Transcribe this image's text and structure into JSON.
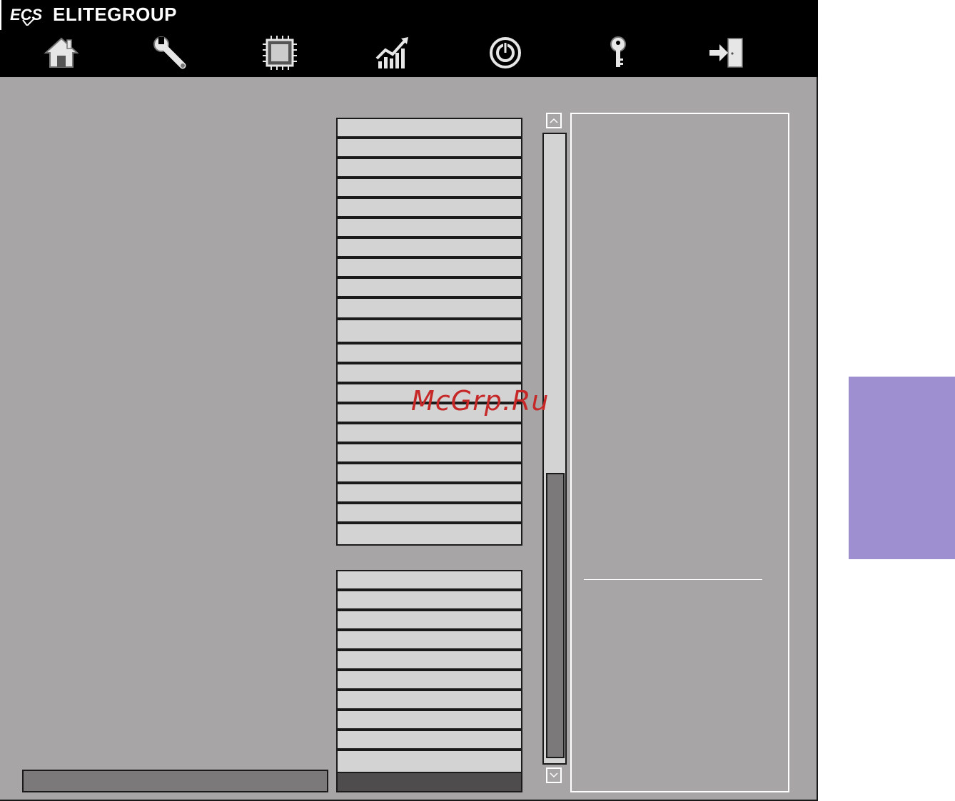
{
  "header": {
    "brand_logo": "ECS",
    "brand_name": "ELITEGROUP",
    "nav_items": [
      {
        "icon": "home-icon"
      },
      {
        "icon": "wrench-icon"
      },
      {
        "icon": "chip-icon"
      },
      {
        "icon": "chart-icon"
      },
      {
        "icon": "power-icon"
      },
      {
        "icon": "key-icon"
      },
      {
        "icon": "exit-icon"
      }
    ]
  },
  "watermark": "McGrp.Ru",
  "scrollbar": {
    "position_fraction": 0.54
  },
  "colors": {
    "window_bg": "#a7a5a6",
    "row_bg": "#d3d3d3",
    "header_bg": "#000000",
    "side_tab": "#9d8fd0",
    "watermark": "#c62828"
  }
}
